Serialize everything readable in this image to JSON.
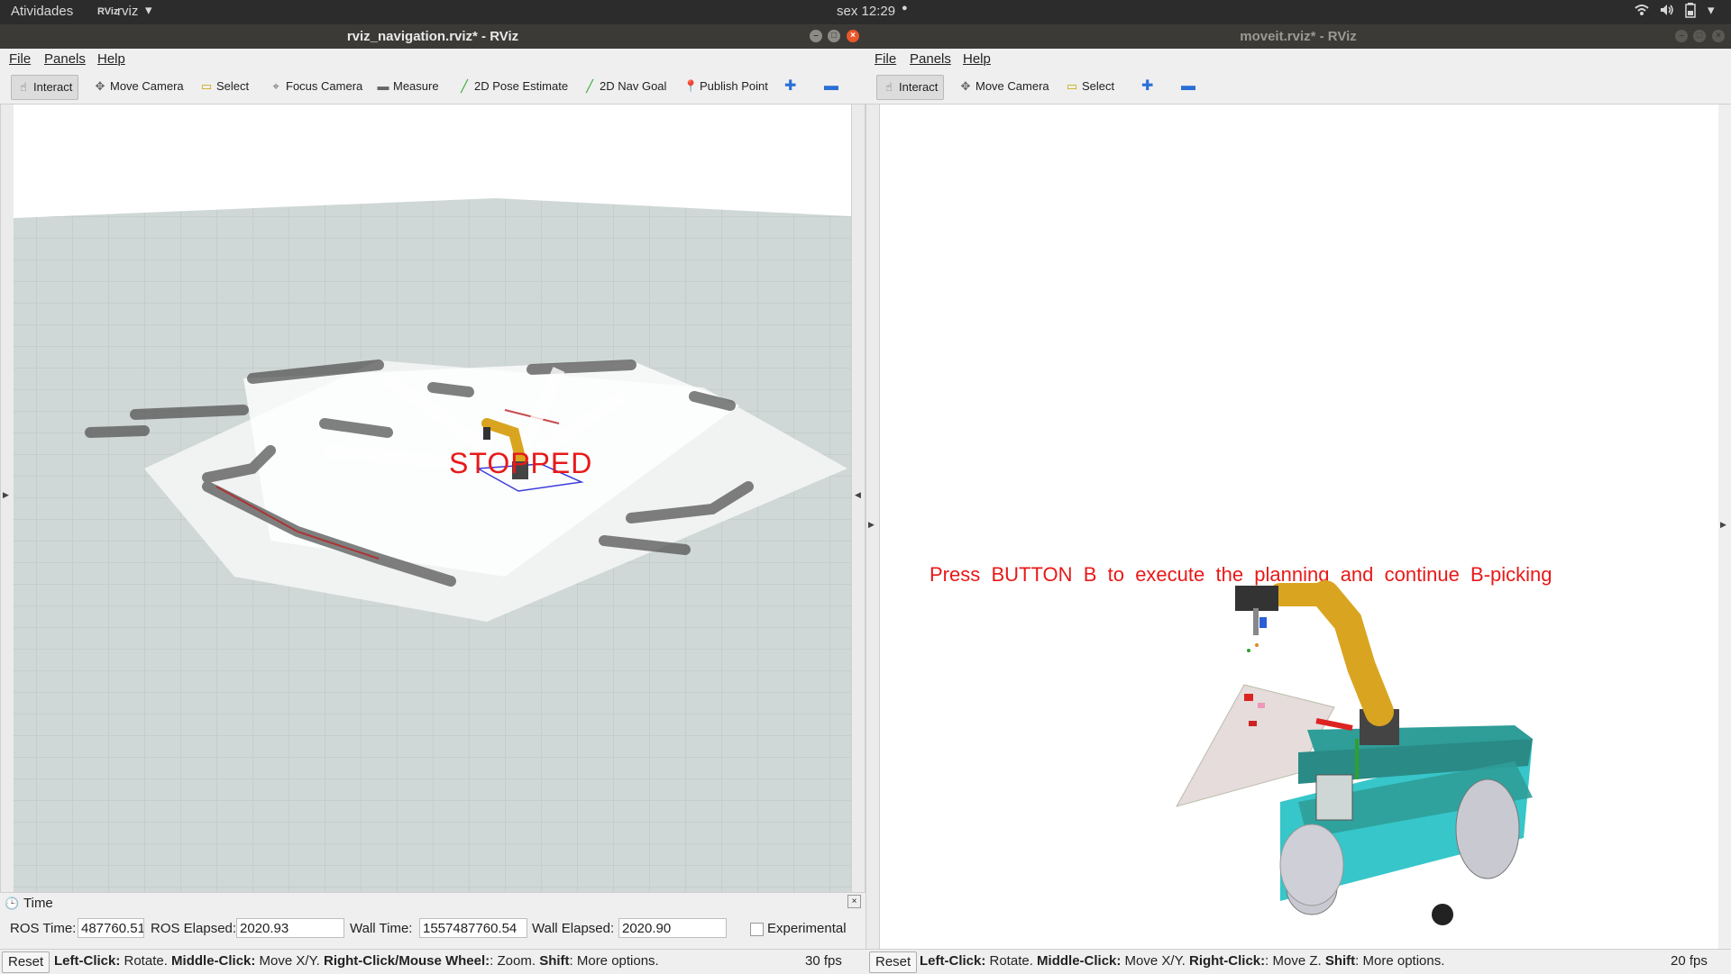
{
  "system_bar": {
    "activities": "Atividades",
    "app_icon": "RViz",
    "app_name": "rviz",
    "clock": "sex 12:29"
  },
  "left_window": {
    "title": "rviz_navigation.rviz* - RViz",
    "menu": [
      "File",
      "Panels",
      "Help"
    ],
    "tools": [
      "Interact",
      "Move Camera",
      "Select",
      "Focus Camera",
      "Measure",
      "2D Pose Estimate",
      "2D Nav Goal",
      "Publish Point"
    ],
    "overlay_text": "STOPPED",
    "time_panel": {
      "title": "Time",
      "ros_time_label": "ROS Time:",
      "ros_time_value": "487760.51",
      "ros_elapsed_label": "ROS Elapsed:",
      "ros_elapsed_value": "2020.93",
      "wall_time_label": "Wall Time:",
      "wall_time_value": "1557487760.54",
      "wall_elapsed_label": "Wall Elapsed:",
      "wall_elapsed_value": "2020.90",
      "experimental_label": "Experimental"
    },
    "status": {
      "reset": "Reset",
      "b1": "Left-Click:",
      "t1": " Rotate. ",
      "b2": "Middle-Click:",
      "t2": " Move X/Y. ",
      "b3": "Right-Click/Mouse Wheel:",
      "t3": ": Zoom. ",
      "b4": "Shift",
      "t4": ": More options.",
      "fps": "30 fps"
    }
  },
  "right_window": {
    "title": "moveit.rviz* - RViz",
    "menu": [
      "File",
      "Panels",
      "Help"
    ],
    "tools": [
      "Interact",
      "Move Camera",
      "Select"
    ],
    "overlay_text": "Press  BUTTON  B  to  execute  the  planning  and  continue  B-picking",
    "status": {
      "reset": "Reset",
      "b1": "Left-Click:",
      "t1": " Rotate. ",
      "b2": "Middle-Click:",
      "t2": " Move X/Y. ",
      "b3": "Right-Click:",
      "t3": ": Move Z. ",
      "b4": "Shift",
      "t4": ": More options.",
      "fps": "20 fps"
    }
  },
  "colors": {
    "overlay_red": "#e81919",
    "robot_teal": "#37c6c9",
    "robot_arm": "#d9a520",
    "grid_bg": "#cfd8d6"
  }
}
